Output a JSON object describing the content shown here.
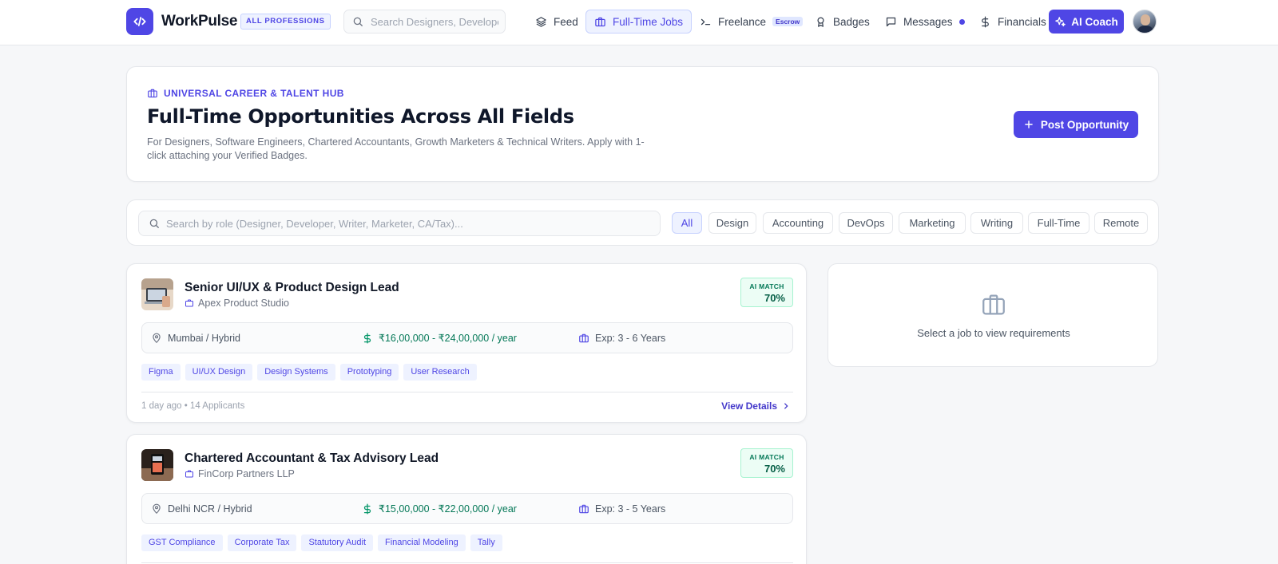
{
  "brand": {
    "name": "WorkPulse",
    "badge": "ALL PROFESSIONS",
    "accent": "#4f46e5"
  },
  "nav": {
    "search_placeholder": "Search Designers, Developers...",
    "items": [
      {
        "label": "Feed",
        "icon": "layers-icon"
      },
      {
        "label": "Full-Time Jobs",
        "icon": "briefcase-icon",
        "active": true
      },
      {
        "label": "Freelance",
        "icon": "terminal-icon",
        "badge": "Escrow"
      },
      {
        "label": "Badges",
        "icon": "award-icon"
      },
      {
        "label": "Messages",
        "icon": "message-icon",
        "dot": true
      },
      {
        "label": "Financials",
        "icon": "dollar-icon"
      }
    ],
    "ai_coach": "AI Coach"
  },
  "hero": {
    "kicker": "UNIVERSAL CAREER & TALENT HUB",
    "title": "Full-Time Opportunities Across All Fields",
    "description": "For Designers, Software Engineers, Chartered Accountants, Growth Marketers & Technical Writers. Apply with 1-click attaching your Verified Badges.",
    "post_button": "Post Opportunity"
  },
  "filters": {
    "search_placeholder": "Search by role (Designer, Developer, Writer, Marketer, CA/Tax)...",
    "chips": [
      "All",
      "Design",
      "Accounting",
      "DevOps",
      "Marketing",
      "Writing",
      "Full-Time",
      "Remote"
    ],
    "active_chip": "All"
  },
  "jobs": [
    {
      "title": "Senior UI/UX & Product Design Lead",
      "company": "Apex Product Studio",
      "ai_match_label": "AI MATCH",
      "ai_match_value": "70%",
      "location": "Mumbai / Hybrid",
      "salary": "₹16,00,000 - ₹24,00,000 / year",
      "experience": "Exp: 3 - 6 Years",
      "tags": [
        "Figma",
        "UI/UX Design",
        "Design Systems",
        "Prototyping",
        "User Research"
      ],
      "meta": "1 day ago • 14 Applicants",
      "cta": "View Details"
    },
    {
      "title": "Chartered Accountant & Tax Advisory Lead",
      "company": "FinCorp Partners LLP",
      "ai_match_label": "AI MATCH",
      "ai_match_value": "70%",
      "location": "Delhi NCR / Hybrid",
      "salary": "₹15,00,000 - ₹22,00,000 / year",
      "experience": "Exp: 3 - 5 Years",
      "tags": [
        "GST Compliance",
        "Corporate Tax",
        "Statutory Audit",
        "Financial Modeling",
        "Tally"
      ],
      "meta": "",
      "cta": ""
    }
  ],
  "side_panel": {
    "message": "Select a job to view requirements"
  }
}
